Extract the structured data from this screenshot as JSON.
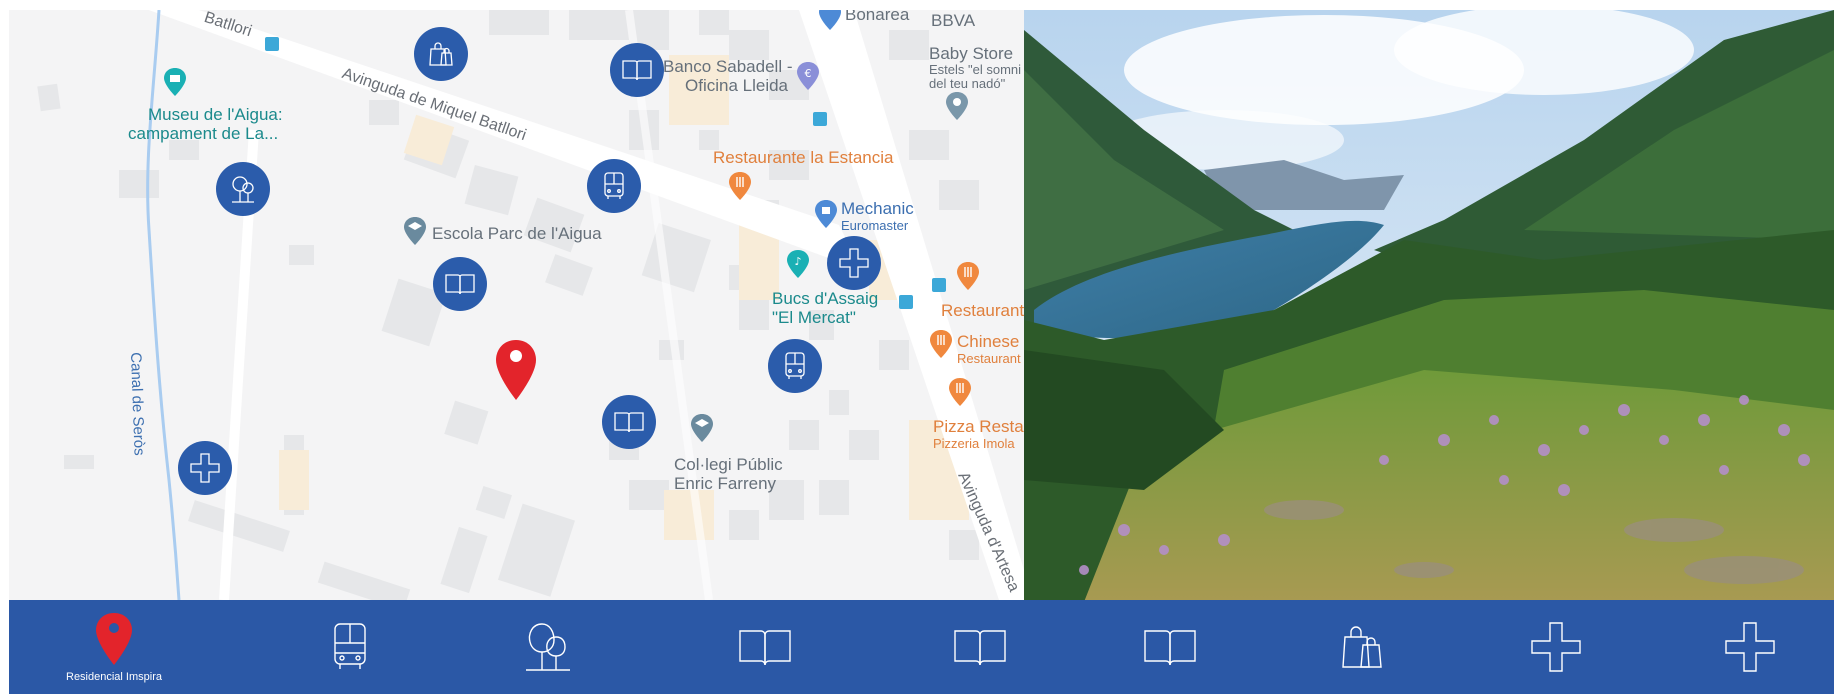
{
  "map": {
    "roads": {
      "avinguda_miquel_batllori": "Avinguda de Miquel Batllori",
      "batllori": "Batllori",
      "canal_de_seros": "Canal de Seròs",
      "avinguda_artesa": "Avinguda d'Artesa"
    },
    "places": {
      "museu_line1": "Museu de l'Aigua:",
      "museu_line2": "campament de La...",
      "escola": "Escola Parc de l'Aigua",
      "banco_line1": "Banco Sabadell -",
      "banco_line2": "Oficina Lleida",
      "bonarea": "Bonarea",
      "bbva": "BBVA",
      "baby_store": "Baby Store",
      "baby_sub1": "Estels \"el somni",
      "baby_sub2": "del teu nadó\"",
      "restaurante_estancia": "Restaurante la Estancia",
      "mechanic": "Mechanic",
      "euromaster": "Euromaster",
      "bucs_line1": "Bucs d'Assaig",
      "bucs_line2": "\"El Mercat\"",
      "restaurant": "Restaurant",
      "chinese": "Chinese",
      "chinese_sub": "Restaurant",
      "pizza": "Pizza Resta",
      "pizza_sub": "Pizzeria Imola",
      "collegi_line1": "Col·legi Públic",
      "collegi_line2": "Enric Farreny"
    }
  },
  "category_markers": [
    {
      "icon": "shopping-bag-icon"
    },
    {
      "icon": "book-icon"
    },
    {
      "icon": "tree-icon"
    },
    {
      "icon": "bus-icon"
    },
    {
      "icon": "book-icon"
    },
    {
      "icon": "cross-icon"
    },
    {
      "icon": "bus-icon"
    },
    {
      "icon": "book-icon"
    },
    {
      "icon": "cross-icon"
    }
  ],
  "bottom_bar": {
    "items": [
      {
        "icon": "location-pin-icon",
        "label": "Residencial Imspira"
      },
      {
        "icon": "bus-icon"
      },
      {
        "icon": "tree-icon"
      },
      {
        "icon": "book-icon"
      },
      {
        "icon": "book-icon"
      },
      {
        "icon": "book-icon"
      },
      {
        "icon": "shopping-bag-icon"
      },
      {
        "icon": "cross-icon"
      },
      {
        "icon": "cross-icon"
      }
    ]
  },
  "colors": {
    "marker_blue": "#2b5cab",
    "bar_blue": "#2b58a6",
    "pin_red": "#e3242b",
    "teal_label": "#1b8a8c",
    "orange_label": "#e0803d"
  }
}
